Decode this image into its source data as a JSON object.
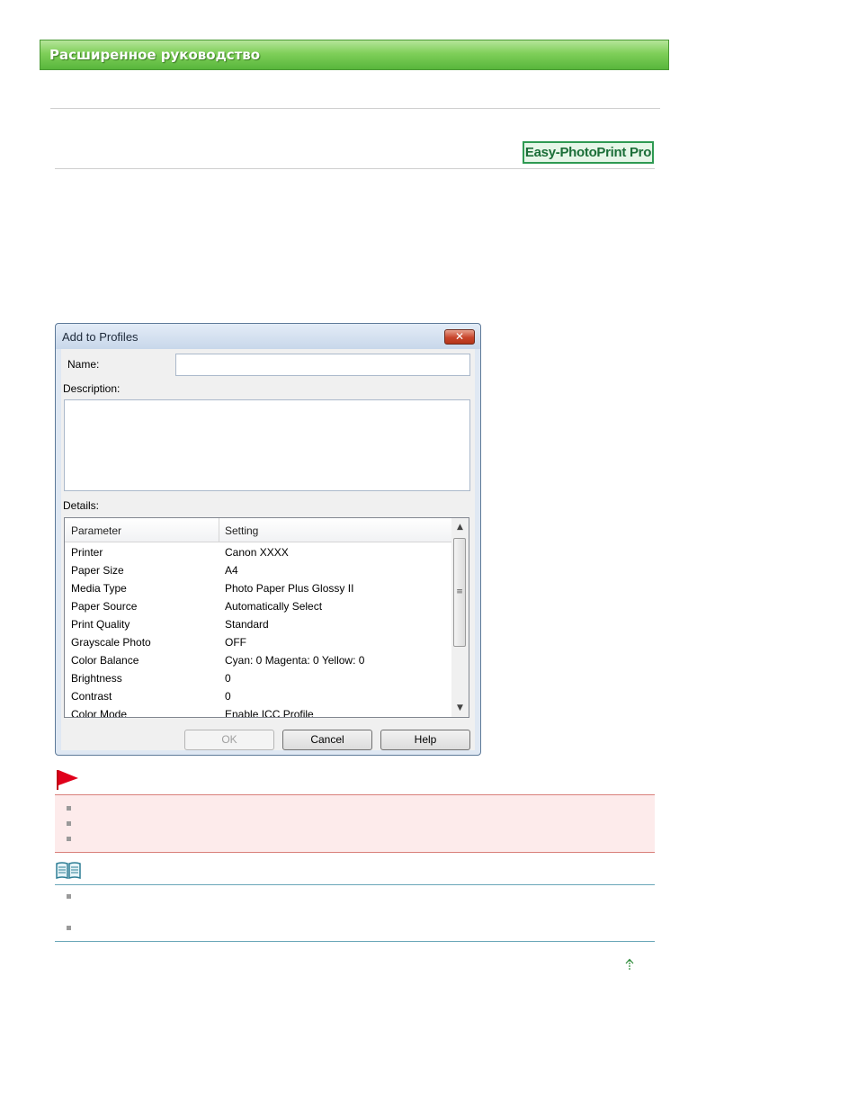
{
  "header": {
    "title": "Расширенное руководство"
  },
  "product_badge": {
    "label": "Easy-PhotoPrint Pro"
  },
  "dialog": {
    "title": "Add to Profiles",
    "close_label": "✕",
    "name_label": "Name:",
    "name_value": "",
    "description_label": "Description:",
    "description_value": "",
    "details_label": "Details:",
    "columns": [
      "Parameter",
      "Setting"
    ],
    "rows": [
      {
        "parameter": "Printer",
        "setting": "Canon XXXX"
      },
      {
        "parameter": "Paper Size",
        "setting": "A4"
      },
      {
        "parameter": "Media Type",
        "setting": "Photo Paper Plus Glossy II"
      },
      {
        "parameter": "Paper Source",
        "setting": "Automatically Select"
      },
      {
        "parameter": "Print Quality",
        "setting": "Standard"
      },
      {
        "parameter": "Grayscale Photo",
        "setting": "OFF"
      },
      {
        "parameter": "Color Balance",
        "setting": "Cyan: 0  Magenta: 0  Yellow: 0"
      },
      {
        "parameter": "Brightness",
        "setting": "0"
      },
      {
        "parameter": "Contrast",
        "setting": "0"
      },
      {
        "parameter": "Color Mode",
        "setting": "Enable ICC Profile"
      }
    ],
    "buttons": {
      "ok": "OK",
      "cancel": "Cancel",
      "help": "Help"
    }
  },
  "icons": {
    "important": "red-flag-icon",
    "note": "book-icon",
    "top": "arrow-up-icon"
  },
  "colors": {
    "header_green": "#6cc24a",
    "badge_green": "#2e9a52",
    "flag_red": "#e0001b",
    "important_bg": "#fdebeb"
  }
}
